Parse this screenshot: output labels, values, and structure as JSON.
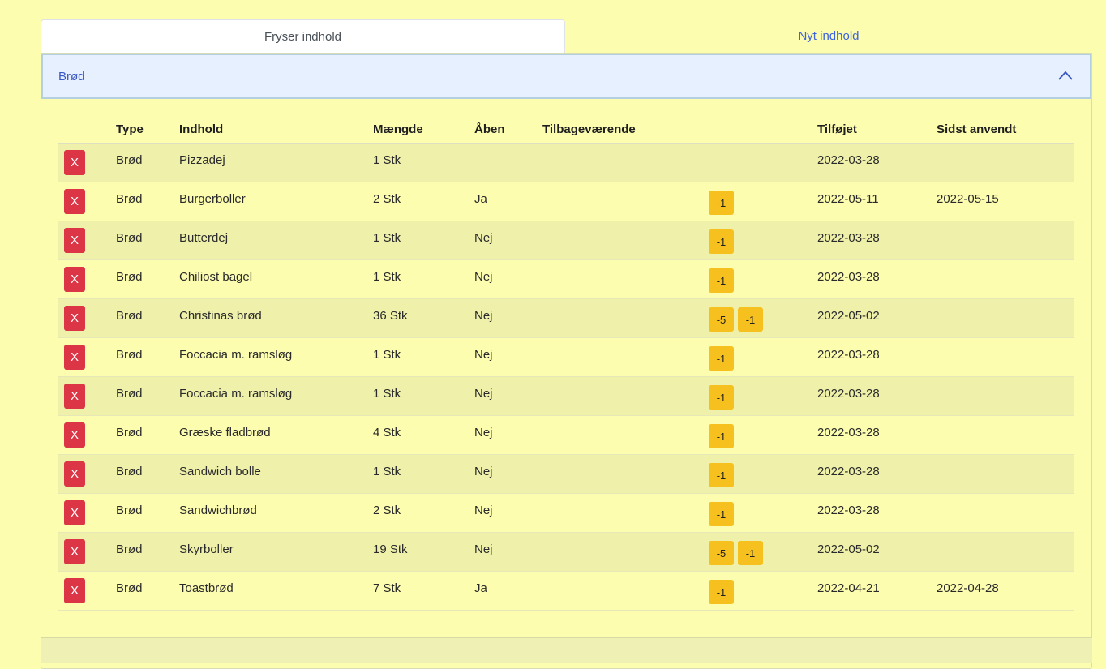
{
  "tabs": {
    "freezer": "Fryser indhold",
    "new": "Nyt indhold"
  },
  "section": {
    "title": "Brød"
  },
  "table": {
    "headers": {
      "type": "Type",
      "content": "Indhold",
      "amount": "Mængde",
      "open": "Åben",
      "remaining": "Tilbageværende",
      "added": "Tilføjet",
      "last_used": "Sidst anvendt"
    },
    "delete_label": "X",
    "rows": [
      {
        "type": "Brød",
        "content": "Pizzadej",
        "amount": "1 Stk",
        "open": "",
        "buttons": [],
        "added": "2022-03-28",
        "last_used": ""
      },
      {
        "type": "Brød",
        "content": "Burgerboller",
        "amount": "2 Stk",
        "open": "Ja",
        "buttons": [
          "-1"
        ],
        "added": "2022-05-11",
        "last_used": "2022-05-15"
      },
      {
        "type": "Brød",
        "content": "Butterdej",
        "amount": "1 Stk",
        "open": "Nej",
        "buttons": [
          "-1"
        ],
        "added": "2022-03-28",
        "last_used": ""
      },
      {
        "type": "Brød",
        "content": "Chiliost bagel",
        "amount": "1 Stk",
        "open": "Nej",
        "buttons": [
          "-1"
        ],
        "added": "2022-03-28",
        "last_used": ""
      },
      {
        "type": "Brød",
        "content": "Christinas brød",
        "amount": "36 Stk",
        "open": "Nej",
        "buttons": [
          "-5",
          "-1"
        ],
        "added": "2022-05-02",
        "last_used": ""
      },
      {
        "type": "Brød",
        "content": "Foccacia m. ramsløg",
        "amount": "1 Stk",
        "open": "Nej",
        "buttons": [
          "-1"
        ],
        "added": "2022-03-28",
        "last_used": ""
      },
      {
        "type": "Brød",
        "content": "Foccacia m. ramsløg",
        "amount": "1 Stk",
        "open": "Nej",
        "buttons": [
          "-1"
        ],
        "added": "2022-03-28",
        "last_used": ""
      },
      {
        "type": "Brød",
        "content": "Græske fladbrød",
        "amount": "4 Stk",
        "open": "Nej",
        "buttons": [
          "-1"
        ],
        "added": "2022-03-28",
        "last_used": ""
      },
      {
        "type": "Brød",
        "content": "Sandwich bolle",
        "amount": "1 Stk",
        "open": "Nej",
        "buttons": [
          "-1"
        ],
        "added": "2022-03-28",
        "last_used": ""
      },
      {
        "type": "Brød",
        "content": "Sandwichbrød",
        "amount": "2 Stk",
        "open": "Nej",
        "buttons": [
          "-1"
        ],
        "added": "2022-03-28",
        "last_used": ""
      },
      {
        "type": "Brød",
        "content": "Skyrboller",
        "amount": "19 Stk",
        "open": "Nej",
        "buttons": [
          "-5",
          "-1"
        ],
        "added": "2022-05-02",
        "last_used": ""
      },
      {
        "type": "Brød",
        "content": "Toastbrød",
        "amount": "7 Stk",
        "open": "Ja",
        "buttons": [
          "-1"
        ],
        "added": "2022-04-21",
        "last_used": "2022-04-28"
      }
    ]
  },
  "colors": {
    "page_bg": "#fdfdb0",
    "delete": "#dc3545",
    "decrement": "#f6c01f",
    "accent": "#3d63dd"
  },
  "icons": {
    "accordion_toggle": "chevron-up-icon"
  }
}
